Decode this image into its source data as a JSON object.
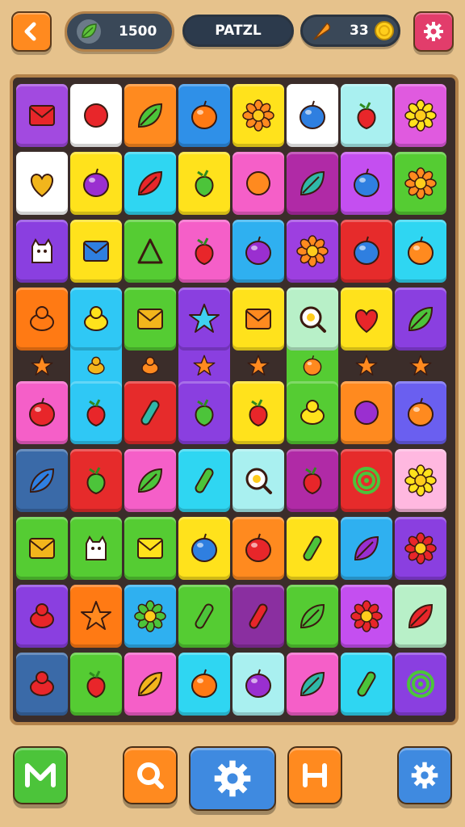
{
  "hud": {
    "back_icon": "back-arrow-icon",
    "score_value": "1500",
    "score_icon": "leaf-icon",
    "level_name": "PATZL",
    "coins_value": "33",
    "coins_icon": "coin-icon",
    "currency_icon": "carrot-icon",
    "settings_icon": "gear-icon"
  },
  "board": {
    "rows": [
      [
        {
          "bg": "#a24ae0",
          "icon": "box"
        },
        {
          "bg": "#ffffff",
          "icon": "cookie"
        },
        {
          "bg": "#ff8a1f",
          "icon": "leaf-green"
        },
        {
          "bg": "#2f90e8",
          "icon": "orange"
        },
        {
          "bg": "#ffe21c",
          "icon": "sun-orange"
        },
        {
          "bg": "#ffffff",
          "icon": "plum-blue"
        },
        {
          "bg": "#a9f0f0",
          "icon": "pepper-red"
        },
        {
          "bg": "#e05adf",
          "icon": "flower-yellow"
        }
      ],
      [
        {
          "bg": "#ffffff",
          "icon": "heart-gold"
        },
        {
          "bg": "#ffe21c",
          "icon": "plum-purple"
        },
        {
          "bg": "#2fd6f2",
          "icon": "leaf-red"
        },
        {
          "bg": "#ffe21c",
          "icon": "pepper-green"
        },
        {
          "bg": "#f55fc8",
          "icon": "drop-orange"
        },
        {
          "bg": "#b02aa6",
          "icon": "leaf-teal"
        },
        {
          "bg": "#c44ff0",
          "icon": "berry-blue"
        },
        {
          "bg": "#55cc33",
          "icon": "flower-orange"
        }
      ],
      [
        {
          "bg": "#8a3fe0",
          "icon": "cat-white"
        },
        {
          "bg": "#ffe21c",
          "icon": "square-blue"
        },
        {
          "bg": "#55cc33",
          "icon": "triangle-green"
        },
        {
          "bg": "#f55fc8",
          "icon": "apple-red"
        },
        {
          "bg": "#2fb0f0",
          "icon": "plum-purple"
        },
        {
          "bg": "#9d3fe0",
          "icon": "sun-orange"
        },
        {
          "bg": "#e62b2b",
          "icon": "ball-blue"
        },
        {
          "bg": "#2fd6f2",
          "icon": "ball-orange"
        }
      ],
      [
        {
          "bg": "#ff7a14",
          "icon": "chess-orange"
        },
        {
          "bg": "#2fc8f5",
          "icon": "snail-yellow"
        },
        {
          "bg": "#55cc33",
          "icon": "envelope-gold"
        },
        {
          "bg": "#8a3fe0",
          "icon": "star-cyan"
        },
        {
          "bg": "#ffe21c",
          "icon": "bars-orange"
        },
        {
          "bg": "#b8f0c8",
          "icon": "lens-white"
        },
        {
          "bg": "#ffe21c",
          "icon": "heart-red"
        },
        {
          "bg": "#8a3fe0",
          "icon": "leaf-green"
        }
      ],
      [
        {
          "bg": "#f55fc8",
          "icon": "gem-red"
        },
        {
          "bg": "#2fc8f5",
          "icon": "rose-red"
        },
        {
          "bg": "#e62b2b",
          "icon": "bottle-teal"
        },
        {
          "bg": "#8a3fe0",
          "icon": "pepper-green"
        },
        {
          "bg": "#ffe21c",
          "icon": "strawberry"
        },
        {
          "bg": "#55cc33",
          "icon": "duck-yellow"
        },
        {
          "bg": "#ff8a1f",
          "icon": "candy-purple"
        },
        {
          "bg": "#6a5ff0",
          "icon": "bubble-orange"
        }
      ],
      [
        {
          "bg": "#3a6aa8",
          "icon": "leaf-blue"
        },
        {
          "bg": "#e62b2b",
          "icon": "apple-green"
        },
        {
          "bg": "#f55fc8",
          "icon": "leaf-green"
        },
        {
          "bg": "#2fd6f2",
          "icon": "bolt-green"
        },
        {
          "bg": "#a9f0f0",
          "icon": "egg-pan"
        },
        {
          "bg": "#b02aa6",
          "icon": "apple-red"
        },
        {
          "bg": "#e62b2b",
          "icon": "spiral-green"
        },
        {
          "bg": "#ffb8e0",
          "icon": "flower-yellow"
        }
      ],
      [
        {
          "bg": "#55cc33",
          "icon": "book-gold"
        },
        {
          "bg": "#55cc33",
          "icon": "ghost-white"
        },
        {
          "bg": "#55cc33",
          "icon": "note-yellow"
        },
        {
          "bg": "#ffe21c",
          "icon": "ball-blue"
        },
        {
          "bg": "#ff8a1f",
          "icon": "berry-red"
        },
        {
          "bg": "#ffe21c",
          "icon": "spoon-green"
        },
        {
          "bg": "#2fb0f0",
          "icon": "leaf-purple"
        },
        {
          "bg": "#8a3fe0",
          "icon": "flower-red"
        }
      ],
      [
        {
          "bg": "#8a3fe0",
          "icon": "lemon-slice"
        },
        {
          "bg": "#ff7a14",
          "icon": "star-orange"
        },
        {
          "bg": "#2fb0f0",
          "icon": "flower-green"
        },
        {
          "bg": "#55cc33",
          "icon": "spoon-green"
        },
        {
          "bg": "#8a2fa0",
          "icon": "bottle-red"
        },
        {
          "bg": "#55cc33",
          "icon": "leaf-green"
        },
        {
          "bg": "#c44ff0",
          "icon": "flower-red"
        },
        {
          "bg": "#b8f0c8",
          "icon": "leaf-box"
        }
      ],
      [
        {
          "bg": "#3a6aa8",
          "icon": "banana"
        },
        {
          "bg": "#55cc33",
          "icon": "balloon-red"
        },
        {
          "bg": "#f55fc8",
          "icon": "leaf-gold"
        },
        {
          "bg": "#2fd6f2",
          "icon": "orange"
        },
        {
          "bg": "#a9f0f0",
          "icon": "plum-purple"
        },
        {
          "bg": "#f55fc8",
          "icon": "shoe-teal"
        },
        {
          "bg": "#2fd6f2",
          "icon": "bottle-green"
        },
        {
          "bg": "#8a3fe0",
          "icon": "spiral-green"
        }
      ]
    ],
    "gap_row_icons": [
      "sparkle-orange",
      "bell-gold",
      "mushroom-orange",
      "star-orange",
      "sparkle-orange",
      "ball-orange",
      "sparkle-orange",
      "sparkle-orange"
    ],
    "lanes": [
      {
        "col": 1,
        "color": "#2fc8f5"
      },
      {
        "col": 3,
        "color": "#8a3fe0"
      },
      {
        "col": 5,
        "color": "#55cc33"
      }
    ]
  },
  "controls": {
    "btn1_icon": "m-letter-icon",
    "btn2_icon": "search-icon",
    "btn3_icon": "gear-icon",
    "btn4_icon": "h-letter-icon",
    "btn5_icon": "gear-icon",
    "colors": {
      "green": "#4cc43a",
      "orange": "#ff8a1f",
      "blue": "#3f8ae0"
    }
  }
}
